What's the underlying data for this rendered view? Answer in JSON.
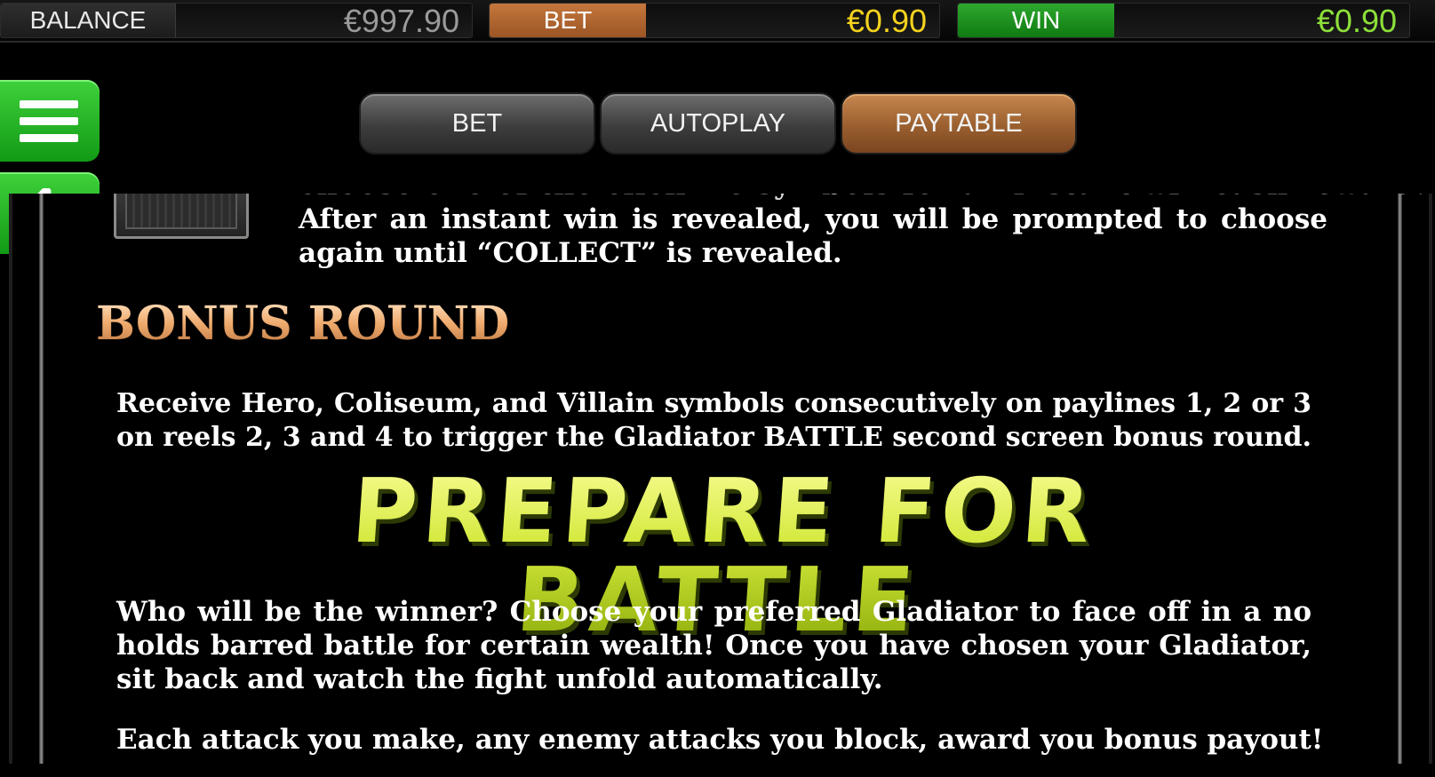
{
  "topbar": {
    "balance_label": "BALANCE",
    "balance_value": "€997.90",
    "bet_label": "BET",
    "bet_value": "€0.90",
    "win_label": "WIN",
    "win_value": "€0.90"
  },
  "side_buttons": {
    "menu_icon": "hamburger-menu-icon",
    "back_icon": "arrow-left-icon"
  },
  "tabs": [
    {
      "label": "BET",
      "active": false
    },
    {
      "label": "AUTOPLAY",
      "active": false
    },
    {
      "label": "PAYTABLE",
      "active": true
    }
  ],
  "colors": {
    "win_green": "#1ea51f",
    "bet_orange": "#b06630",
    "bet_value_yellow": "#f4d21e",
    "win_value_green": "#8de03a",
    "banner_lime": "#c8e020"
  },
  "paytable": {
    "instant_win_cut": "choose one of the  click me  symbols for an instant win cash reward.",
    "instant_win_text": "After an instant win is revealed, you will be prompted to choose again until “COLLECT” is revealed.",
    "bonus_heading": "BONUS ROUND",
    "trigger_text": "Receive Hero, Coliseum, and Villain symbols consecutively on paylines 1, 2 or 3 on reels 2, 3 and 4 to trigger the Gladiator BATTLE second screen bonus round.",
    "battle_banner": "PREPARE FOR BATTLE",
    "winner_text": "Who will be the winner? Choose your preferred Gladiator to face off in a no holds barred battle for certain wealth! Once you have chosen your Gladiator, sit back and watch the fight unfold automatically.",
    "attack_text": "Each attack you make, any enemy attacks you block, award you bonus payout!"
  }
}
